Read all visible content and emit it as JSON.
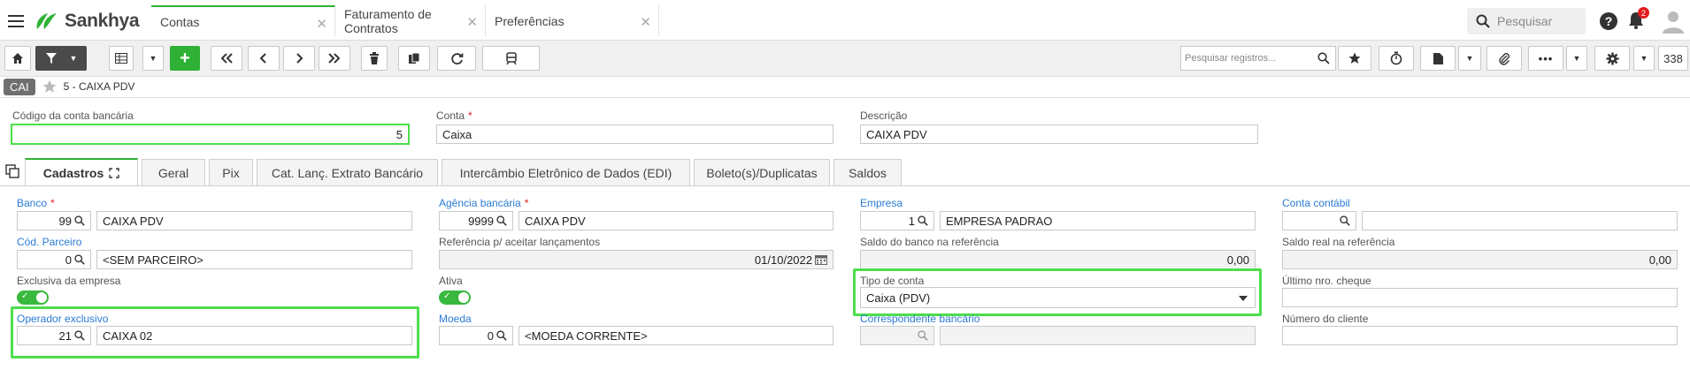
{
  "app": {
    "logo_text": "Sankhya"
  },
  "tabs": [
    {
      "label": "Contas"
    },
    {
      "label": "Faturamento de Contratos"
    },
    {
      "label": "Preferências"
    }
  ],
  "header": {
    "search_label": "Pesquisar",
    "notifications_count": "2"
  },
  "toolbar": {
    "search_placeholder": "Pesquisar registros...",
    "record_count": "338"
  },
  "breadcrumb": {
    "badge": "CAI",
    "title": "5 - CAIXA PDV"
  },
  "top_form": {
    "codigo_label": "Código da conta bancária",
    "codigo_value": "5",
    "conta_label": "Conta",
    "conta_required": "*",
    "conta_value": "Caixa",
    "descricao_label": "Descrição",
    "descricao_value": "CAIXA PDV"
  },
  "form_tabs": [
    {
      "label": "Cadastros"
    },
    {
      "label": "Geral"
    },
    {
      "label": "Pix"
    },
    {
      "label": "Cat. Lanç. Extrato Bancário"
    },
    {
      "label": "Intercâmbio Eletrônico de Dados (EDI)"
    },
    {
      "label": "Boleto(s)/Duplicatas"
    },
    {
      "label": "Saldos"
    }
  ],
  "col1": {
    "banco_label": "Banco",
    "banco_required": "*",
    "banco_code": "99",
    "banco_name": "CAIXA PDV",
    "parceiro_label": "Cód. Parceiro",
    "parceiro_code": "0",
    "parceiro_name": "<SEM PARCEIRO>",
    "exclusiva_label": "Exclusiva da empresa",
    "operador_label": "Operador exclusivo",
    "operador_code": "21",
    "operador_name": "CAIXA 02"
  },
  "col2": {
    "agencia_label": "Agência bancária",
    "agencia_required": "*",
    "agencia_code": "9999",
    "agencia_name": "CAIXA PDV",
    "referencia_label": "Referência p/ aceitar lançamentos",
    "referencia_value": "01/10/2022",
    "ativa_label": "Ativa",
    "moeda_label": "Moeda",
    "moeda_code": "0",
    "moeda_name": "<MOEDA CORRENTE>"
  },
  "col3": {
    "empresa_label": "Empresa",
    "empresa_code": "1",
    "empresa_name": "EMPRESA PADRAO",
    "saldo_banco_label": "Saldo do banco na referência",
    "saldo_banco_value": "0,00",
    "tipo_label": "Tipo de conta",
    "tipo_value": "Caixa (PDV)",
    "correspondente_label": "Correspondente bancário"
  },
  "col4": {
    "contabil_label": "Conta contábil",
    "saldo_real_label": "Saldo real na referência",
    "saldo_real_value": "0,00",
    "ultimo_cheque_label": "Último nro. cheque",
    "numero_cliente_label": "Número do cliente"
  },
  "colors": {
    "accent": "#2eb135",
    "link": "#2a7bd4",
    "highlight": "#4cde4c",
    "required": "#e21b1b"
  }
}
